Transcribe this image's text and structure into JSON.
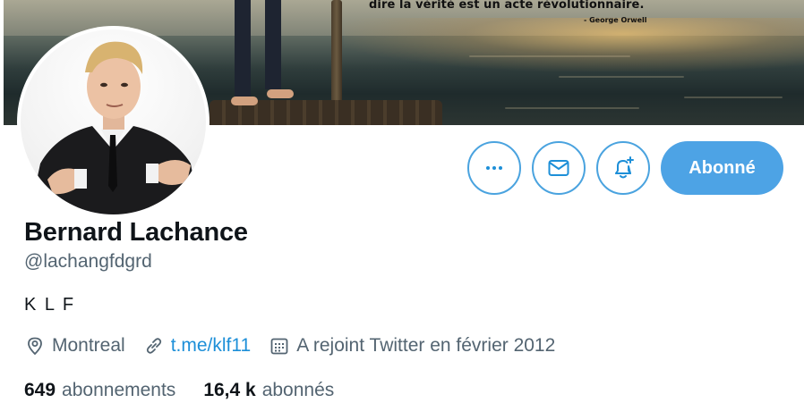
{
  "banner": {
    "quote": "dire la vérité est un acte révolutionnaire.",
    "quote_author": "- George Orwell"
  },
  "actions": {
    "more_label": "More",
    "message_label": "Message",
    "notify_label": "Notifications",
    "follow_label": "Abonné"
  },
  "profile": {
    "name": "Bernard Lachance",
    "handle": "@lachangfdgrd",
    "bio": "K L F",
    "location": "Montreal",
    "website": "t.me/klf11",
    "joined": "A rejoint Twitter en février 2012"
  },
  "stats": {
    "following_count": "649",
    "following_label": "abonnements",
    "followers_count": "16,4 k",
    "followers_label": "abonnés"
  },
  "colors": {
    "accent": "#1d9bf0",
    "follow_button": "#4da3e5",
    "secondary_text": "#536471"
  }
}
